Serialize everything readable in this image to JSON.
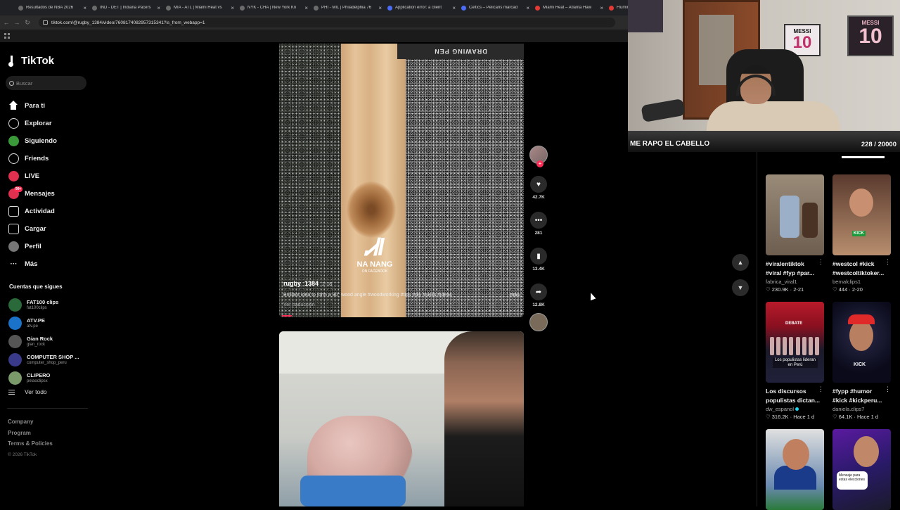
{
  "browser": {
    "tabs": [
      {
        "label": "Resultados de NBA 2026",
        "fav": "gray"
      },
      {
        "label": "IND - DET | Indiana Pacers",
        "fav": "gray"
      },
      {
        "label": "MIA - ATL | Miami Heat vs",
        "fav": "gray"
      },
      {
        "label": "NYK - CHA | New York Kn",
        "fav": "gray"
      },
      {
        "label": "PHI - MIL | Philadelphia 76",
        "fav": "gray"
      },
      {
        "label": "Application error: a client",
        "fav": "blue"
      },
      {
        "label": "Celtics – Pelicans marcad",
        "fav": "blue"
      },
      {
        "label": "Miami Heat – Atlanta Haw",
        "fav": "red"
      },
      {
        "label": "Flumine",
        "fav": "red"
      }
    ],
    "url": "tiktok.com/@rugby_1384/video/7608174082957315341?is_from_webapp=1"
  },
  "sidebar": {
    "logo": "TikTok",
    "search_placeholder": "Buscar",
    "nav": [
      {
        "label": "Para ti",
        "icon": "home-icon"
      },
      {
        "label": "Explorar",
        "icon": "compass-icon"
      },
      {
        "label": "Siguiendo",
        "icon": "following-icon"
      },
      {
        "label": "Friends",
        "icon": "friends-icon"
      },
      {
        "label": "LIVE",
        "icon": "live-icon"
      },
      {
        "label": "Mensajes",
        "icon": "messages-icon",
        "badge": "99+"
      },
      {
        "label": "Actividad",
        "icon": "activity-icon"
      },
      {
        "label": "Cargar",
        "icon": "upload-icon"
      },
      {
        "label": "Perfil",
        "icon": "profile-icon"
      },
      {
        "label": "Más",
        "icon": "more-icon"
      }
    ],
    "following_title": "Cuentas que sigues",
    "following": [
      {
        "name": "FAT100 clips",
        "user": "fat100clips",
        "color": "#2a6a3a"
      },
      {
        "name": "ATV.PE",
        "user": "atv.pe",
        "color": "#1a73c8"
      },
      {
        "name": "Gian Rock",
        "user": "gian_rock",
        "color": "#555555"
      },
      {
        "name": "COMPUTER SHOP ...",
        "user": "computer_shop_peru",
        "color": "#3a3a8a"
      },
      {
        "name": "CLIPERO",
        "user": "pelaoclipsx",
        "color": "#7a9a6a"
      }
    ],
    "see_all": "Ver todo",
    "footer": [
      "Company",
      "Program",
      "Terms & Policies"
    ],
    "copyright": "© 2026 TikTok"
  },
  "video": {
    "pen_text": "DRAWING PEN",
    "watermark_mark": "Ꮧl",
    "watermark_name": "NA NANG",
    "watermark_sub": "ON FACEBOOK",
    "username": "rugby_1384",
    "date": "2-18",
    "caption": "Brilliant idea to form a 90° wood angle  #woodworking #tips #diy #skills #ideas",
    "more": "más",
    "translate": "Ver traducción",
    "likes": "42.7K",
    "comments": "281",
    "saves": "13.4K",
    "shares": "12.8K"
  },
  "webcam": {
    "frame1_title": "MESSI",
    "frame1_num": "10",
    "frame2_title": "MESSI",
    "frame2_num": "10",
    "label": "ME RAPO EL CABELLO",
    "counter": "228 / 20000"
  },
  "recommended": [
    {
      "title": "#viralentiktok #viral #fyp #par...",
      "author": "fabrica_viral1",
      "likes": "230.9K",
      "date": "2-21",
      "verified": false
    },
    {
      "title": "#westcol #kick #westcoltiktoker...",
      "author": "bernalclips1",
      "likes": "444",
      "date": "2-20",
      "verified": false
    },
    {
      "title": "Los discursos populistas dictan...",
      "author": "dw_espanol",
      "likes": "316.2K",
      "date": "Hace 1 d",
      "verified": true
    },
    {
      "title": "#fypp #humor #kick #kickperu...",
      "author": "daniela.clips7",
      "likes": "64.1K",
      "date": "Hace 1 d",
      "verified": false
    },
    {
      "title": "",
      "author": "",
      "likes": "",
      "date": "",
      "verified": false
    },
    {
      "title": "",
      "author": "",
      "likes": "",
      "date": "",
      "verified": false
    }
  ],
  "thumb_text": {
    "t2_tag": "KICK",
    "t3_header": "DEBATE",
    "t3_caption": "Los populistas lideran en Perú",
    "t4_tag": "KICK",
    "t6_bubble": "Mensaje para estas elecciones"
  }
}
